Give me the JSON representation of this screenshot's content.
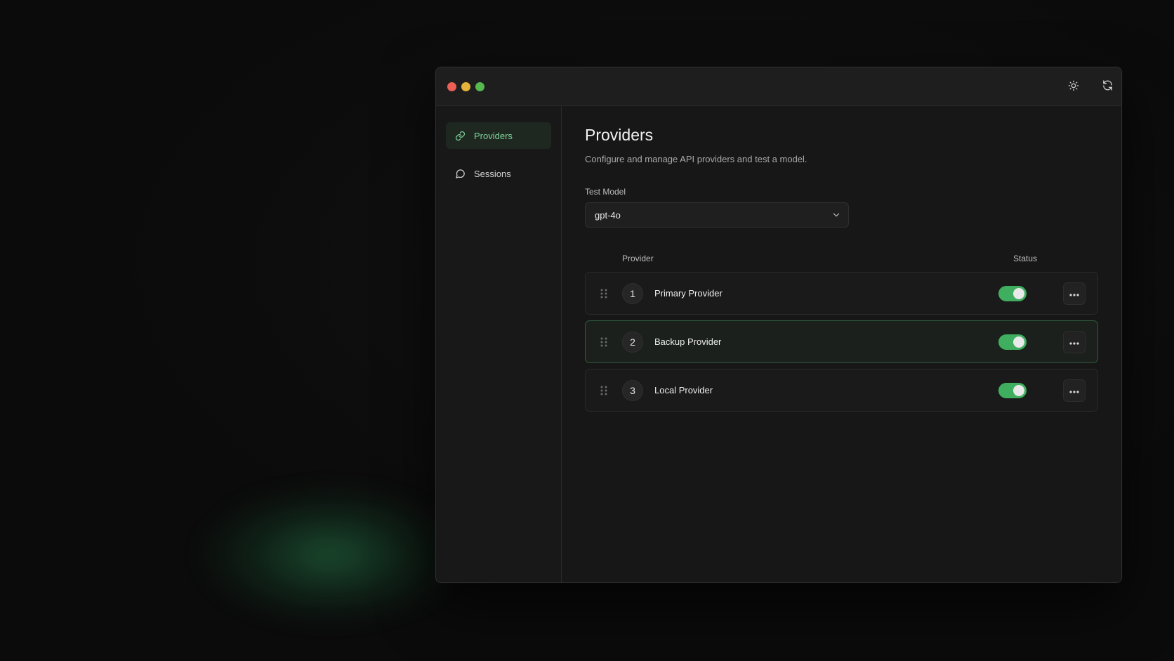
{
  "window": {
    "traffic_lights": [
      "close",
      "minimize",
      "maximize"
    ],
    "toolbar_icons": [
      "sun-icon",
      "refresh-icon"
    ]
  },
  "sidebar": {
    "items": [
      {
        "label": "Providers",
        "icon": "link-icon",
        "active": true
      },
      {
        "label": "Sessions",
        "icon": "chat-bubble-icon",
        "active": false
      }
    ]
  },
  "main": {
    "title": "Providers",
    "subtitle": "Configure and manage API providers and test a model.",
    "test_model": {
      "label": "Test Model",
      "value": "gpt-4o"
    },
    "table": {
      "columns": [
        "Provider",
        "Status"
      ],
      "rows": [
        {
          "index": "1",
          "name": "Primary Provider",
          "enabled": true,
          "highlighted": false
        },
        {
          "index": "2",
          "name": "Backup Provider",
          "enabled": true,
          "highlighted": true
        },
        {
          "index": "3",
          "name": "Local Provider",
          "enabled": true,
          "highlighted": false
        }
      ]
    }
  },
  "colors": {
    "accent": "#3fae5f",
    "active_text": "#7fd49b",
    "background": "#0b0b0b"
  }
}
